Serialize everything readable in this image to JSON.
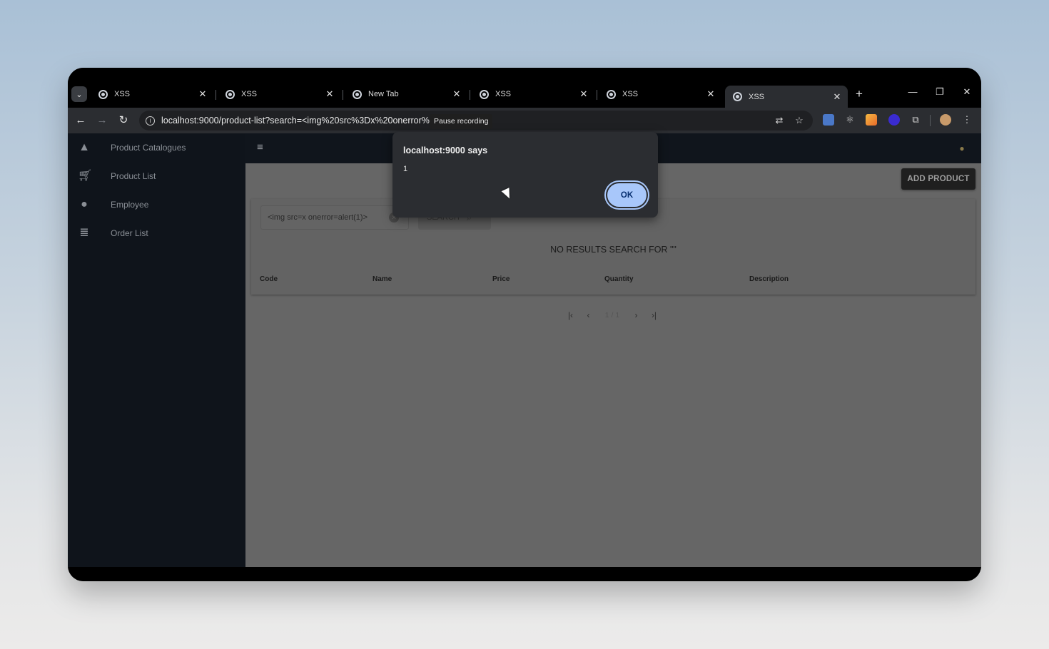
{
  "browser": {
    "tabs": [
      {
        "title": "XSS",
        "active": false
      },
      {
        "title": "XSS",
        "active": false
      },
      {
        "title": "New Tab",
        "active": false
      },
      {
        "title": "XSS",
        "active": false
      },
      {
        "title": "XSS",
        "active": false
      },
      {
        "title": "XSS",
        "active": true
      }
    ],
    "close_glyph": "✕",
    "new_tab_glyph": "+",
    "url": "localhost:9000/product-list?search=<img%20src%3Dx%20onerror%3Dalert(1)>",
    "tooltip": "Pause recording"
  },
  "sidebar": {
    "items": [
      {
        "label": "Product Catalogues",
        "icon": "shapes-icon"
      },
      {
        "label": "Product List",
        "icon": "cart-icon"
      },
      {
        "label": "Employee",
        "icon": "person-icon"
      },
      {
        "label": "Order List",
        "icon": "list-icon"
      }
    ]
  },
  "main": {
    "add_product_label": "ADD PRODUCT",
    "search": {
      "value": "<img src=x onerror=alert(1)>",
      "button_label": "SEARCH"
    },
    "no_results": "NO RESULTS SEARCH FOR \"\"",
    "table": {
      "columns": [
        "Code",
        "Name",
        "Price",
        "Quantity",
        "Description"
      ]
    },
    "pager": {
      "text": "1 / 1"
    }
  },
  "dialog": {
    "title": "localhost:9000 says",
    "message": "1",
    "ok_label": "OK"
  },
  "colors": {
    "dialog_button": "#a8c7fa",
    "sidebar_bg": "#0f141b",
    "content_overlay": "#666666"
  }
}
